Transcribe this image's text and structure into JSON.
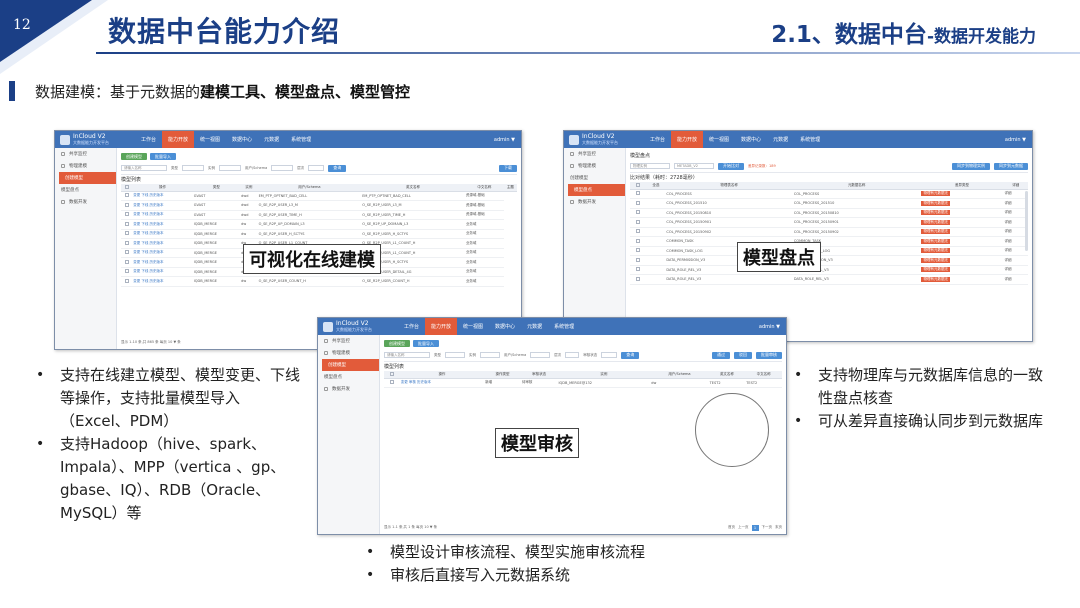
{
  "header": {
    "page_number": "12",
    "title": "数据中台能力介绍",
    "section_main": "2.1、数据中台",
    "section_sub": "-数据开发能力"
  },
  "subtitle": {
    "prefix": "数据建模：基于元数据的",
    "highlight": "建模工具、模型盘点、模型管控"
  },
  "app": {
    "logo_name": "InCloud",
    "logo_tag": "V2",
    "logo_sub": "大数据能力开发平台",
    "nav": [
      "工作台",
      "能力开放",
      "统一视图",
      "数据中心",
      "元数据",
      "系统管理"
    ],
    "user": "admin ▼",
    "sidebar": [
      "共享监控",
      "物理建模",
      "创建模型",
      "模型盘点",
      "数据开发"
    ]
  },
  "screen_left": {
    "buttons": [
      "创建模型",
      "批量导入"
    ],
    "filter_labels": [
      "类型",
      "实例",
      "用户/Schema",
      "层次"
    ],
    "filter_placeholder": "请输入名称",
    "query_btn": "查询",
    "download_btn": "下载",
    "section": "模型列表",
    "columns": [
      "",
      "操作",
      "类型",
      "实例",
      "用户/Schema",
      "英文名称",
      "中文名称",
      "主题"
    ],
    "rows": [
      [
        "",
        "变更 下线 历史版本",
        "GVAST",
        "dwd",
        "EM_PTP_OPTNET_BAD_CELL",
        "EM_PTP_OPTNET_BAD_CELL",
        "资源域-基础"
      ],
      [
        "",
        "变更 下线 历史版本",
        "GVAST",
        "dwd",
        "O_SE_R2P_USER_L3_M",
        "O_SE_R2P_USER_L3_M",
        "资源域-基础"
      ],
      [
        "",
        "变更 下线 历史版本",
        "GVAST",
        "dwd",
        "O_SE_R2P_USER_TIME_H",
        "O_SE_R2P_USER_TIME_H",
        "资源域-基础"
      ],
      [
        "",
        "变更 下线 历史版本",
        "IQDB_MERGE",
        "dw",
        "O_SE_R2P_UP_DOMAIN_L3",
        "O_SE_R2P_UP_DOMAIN_L3",
        "业务域"
      ],
      [
        "",
        "变更 下线 历史版本",
        "IQDB_MERGE",
        "dw",
        "O_SE_R2P_USER_H_SCTYS",
        "O_SE_R2P_USER_H_SCTYS",
        "业务域"
      ],
      [
        "",
        "变更 下线 历史版本",
        "IQDB_MERGE",
        "dw",
        "O_SE_R2P_USER_L1_COUNT",
        "O_SE_R2P_USER_L1_COUNT_H",
        "业务域"
      ],
      [
        "",
        "变更 下线 历史版本",
        "IQDB_MERGE",
        "dw",
        "O_SE_R2P_USER_L1_COUNT_H",
        "O_SE_R2P_USER_L1_COUNT_H",
        "业务域"
      ],
      [
        "",
        "变更 下线 历史版本",
        "IQDB_MERGE",
        "dw",
        "O_SE_R2P_USER_H_SCTYS",
        "O_SE_R2P_USER_H_SCTYS",
        "业务域"
      ],
      [
        "",
        "变更 下线 历史版本",
        "IQDB_MERGE",
        "dw",
        "O_SE_R2P_USER_DETAIL_4G",
        "O_SE_R2P_USER_DETAIL_4G",
        "业务域"
      ],
      [
        "",
        "变更 下线 历史版本",
        "IQDB_MERGE",
        "dw",
        "O_SE_R2P_USER_COUNT_H",
        "O_SE_R2P_USER_COUNT_H",
        "业务域"
      ]
    ],
    "pager": "显示 1-10 条,共 865 条 每页 10 ▼ 条",
    "label": "可视化在线建模"
  },
  "screen_right": {
    "section": "模型盘点",
    "filter_value": "物理实例",
    "filter_value2": "METADB_V2",
    "btn_compare": "开始比对",
    "diff_text": "差异记录数：189",
    "btn_sync1": "同步到物理实例",
    "btn_sync2": "同步到元数据",
    "result": "比对结果（耗时：2728毫秒）",
    "columns": [
      "",
      "全选",
      "物理表名称",
      "元数据名称",
      "差异类型",
      "详细"
    ],
    "rows": [
      [
        "",
        "",
        "COL_PROCESS",
        "COL_PROCESS",
        "物理有元数据无",
        "详细"
      ],
      [
        "",
        "",
        "COL_PROCESS_201510",
        "COL_PROCESS_201510",
        "物理有元数据无",
        "详细"
      ],
      [
        "",
        "",
        "COL_PROCESS_20150810",
        "COL_PROCESS_20150810",
        "物理有元数据无",
        "详细"
      ],
      [
        "",
        "",
        "COL_PROCESS_20150901",
        "COL_PROCESS_20150901",
        "物理有元数据无",
        "详细"
      ],
      [
        "",
        "",
        "COL_PROCESS_20150902",
        "COL_PROCESS_20150902",
        "物理有元数据无",
        "详细"
      ],
      [
        "",
        "",
        "COMMON_TASK",
        "COMMON_TASK",
        "物理有元数据无",
        "详细"
      ],
      [
        "",
        "",
        "COMMON_TASK_LOG",
        "COMMON_TASK_LOG",
        "物理有元数据无",
        "详细"
      ],
      [
        "",
        "",
        "DATA_PERMISSION_V3",
        "DATA_PERMISSION_V3",
        "物理有元数据无",
        "详细"
      ],
      [
        "",
        "",
        "DATA_ROLE_REL_V3",
        "DATA_ROLE_REL_V3",
        "物理有元数据无",
        "详细"
      ],
      [
        "",
        "",
        "DATA_ROLE_REL_V3",
        "DATA_ROLE_REL_V3",
        "物理有元数据无",
        "详细"
      ]
    ],
    "label": "模型盘点"
  },
  "screen_mid": {
    "buttons": [
      "创建模型",
      "批量导入"
    ],
    "filter_labels": [
      "类型",
      "实例",
      "用户/Schema",
      "层次",
      "审核状态"
    ],
    "filter_placeholder": "请输入名称",
    "query_btn": "查询",
    "action_btns": [
      "通过",
      "驳回",
      "批量审核"
    ],
    "section": "模型列表",
    "columns": [
      "",
      "操作",
      "操作类型",
      "审核状态",
      "实例",
      "用户/Schema",
      "英文名称",
      "中文名称"
    ],
    "rows": [
      [
        "",
        "变更 审核 历史版本",
        "新增",
        "待审核",
        "IQDB_MERGE@132",
        "dw",
        "TEST2",
        "TEST2"
      ]
    ],
    "pager": "显示 1-1 条,共 1 条 每页 10 ▼ 条",
    "pagination": [
      "首页",
      "上一页",
      "1",
      "下一页",
      "末页"
    ],
    "label": "模型审核"
  },
  "bullets_left": [
    "支持在线建立模型、模型变更、下线等操作，支持批量模型导入（Excel、PDM）",
    "支持Hadoop（hive、spark、Impala）、MPP（vertica 、gp、gbase、IQ）、RDB（Oracle、MySQL）等"
  ],
  "bullets_right": [
    "支持物理库与元数据库信息的一致性盘点核查",
    "可从差异直接确认同步到元数据库"
  ],
  "bullets_bottom": [
    "模型设计审核流程、模型实施审核流程",
    "审核后直接写入元数据系统"
  ],
  "colors": {
    "brand": "#1b3f86",
    "nav_bar": "#3f72b8",
    "active": "#e25b3a",
    "green_btn": "#5aa55a",
    "blue_btn": "#4b8fd6"
  }
}
